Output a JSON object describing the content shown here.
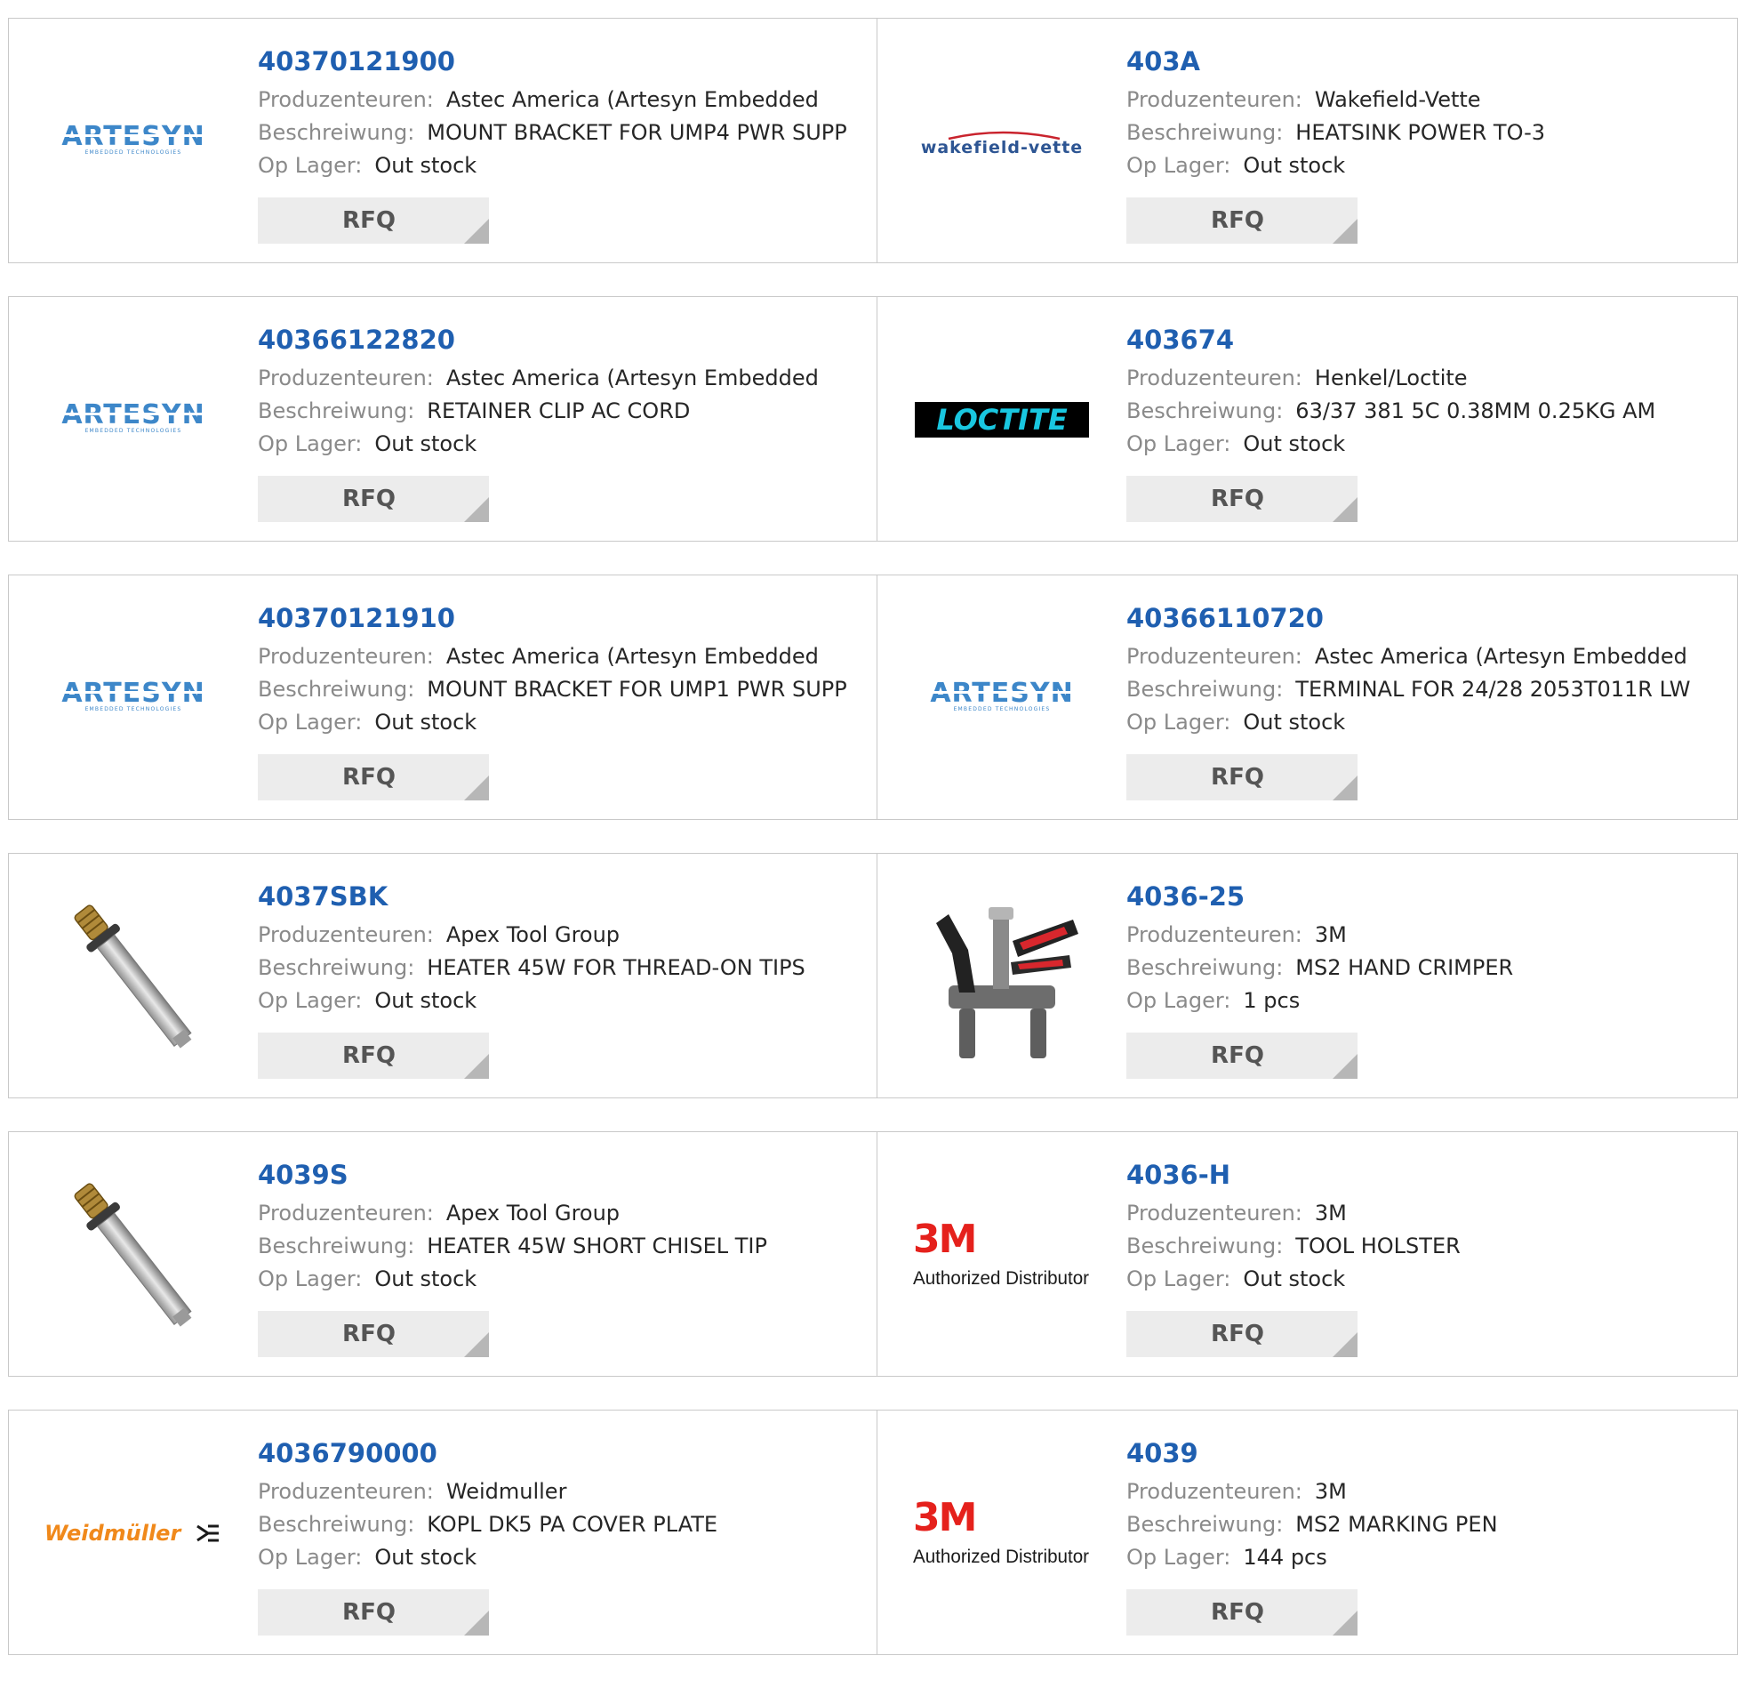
{
  "labels": {
    "manufacturer": "Produzenteuren:",
    "description": "Beschreiwung:",
    "stock": "Op Lager:",
    "rfq": "RFQ"
  },
  "logos": {
    "artesyn": {
      "text": "ARTESYN",
      "subtext": "EMBEDDED TECHNOLOGIES",
      "color": "#3d87c9"
    },
    "wakefield": {
      "text": "wakefield-vette",
      "color": "#2d5593",
      "arc_color": "#c9232d"
    },
    "loctite": {
      "text": "LOCTITE",
      "bg": "#000000",
      "color": "#19c7e0"
    },
    "weidmuller": {
      "text": "Weidmüller",
      "color": "#f0891b"
    },
    "threem": {
      "text": "3M",
      "subtext": "Authorized Distributor",
      "color": "#e5211c"
    }
  },
  "products": [
    {
      "pn": "40370121900",
      "manufacturer": "Astec America (Artesyn Embedded",
      "description": "MOUNT BRACKET FOR UMP4 PWR SUPP",
      "stock": "Out stock",
      "image": "artesyn-logo"
    },
    {
      "pn": "403A",
      "manufacturer": "Wakefield-Vette",
      "description": "HEATSINK POWER TO-3",
      "stock": "Out stock",
      "image": "wakefield-logo"
    },
    {
      "pn": "40366122820",
      "manufacturer": "Astec America (Artesyn Embedded",
      "description": "RETAINER CLIP AC CORD",
      "stock": "Out stock",
      "image": "artesyn-logo"
    },
    {
      "pn": "403674",
      "manufacturer": "Henkel/Loctite",
      "description": "63/37 381 5C 0.38MM 0.25KG AM",
      "stock": "Out stock",
      "image": "loctite-logo"
    },
    {
      "pn": "40370121910",
      "manufacturer": "Astec America (Artesyn Embedded",
      "description": "MOUNT BRACKET FOR UMP1 PWR SUPP",
      "stock": "Out stock",
      "image": "artesyn-logo"
    },
    {
      "pn": "40366110720",
      "manufacturer": "Astec America (Artesyn Embedded",
      "description": "TERMINAL FOR 24/28 2053T011R LW",
      "stock": "Out stock",
      "image": "artesyn-logo"
    },
    {
      "pn": "4037SBK",
      "manufacturer": "Apex Tool Group",
      "description": "HEATER 45W FOR THREAD-ON TIPS",
      "stock": "Out stock",
      "image": "heater-photo"
    },
    {
      "pn": "4036-25",
      "manufacturer": "3M",
      "description": "MS2 HAND CRIMPER",
      "stock": "1 pcs",
      "image": "crimper-photo"
    },
    {
      "pn": "4039S",
      "manufacturer": "Apex Tool Group",
      "description": "HEATER 45W SHORT CHISEL TIP",
      "stock": "Out stock",
      "image": "heater-photo"
    },
    {
      "pn": "4036-H",
      "manufacturer": "3M",
      "description": "TOOL HOLSTER",
      "stock": "Out stock",
      "image": "threem-logo"
    },
    {
      "pn": "4036790000",
      "manufacturer": "Weidmuller",
      "description": "KOPL DK5 PA COVER PLATE",
      "stock": "Out stock",
      "image": "weidmuller-logo"
    },
    {
      "pn": "4039",
      "manufacturer": "3M",
      "description": "MS2 MARKING PEN",
      "stock": "144 pcs",
      "image": "threem-logo"
    }
  ]
}
